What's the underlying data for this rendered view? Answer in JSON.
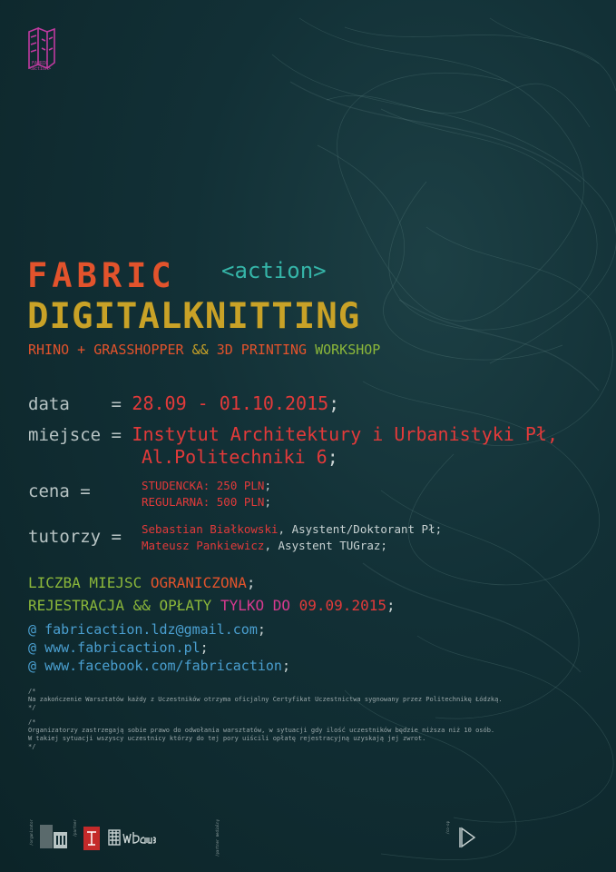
{
  "logo": {
    "caption_line1": "FABRIC",
    "caption_line2": "<action>"
  },
  "title": {
    "fabric": "FABRIC",
    "action": "<action>",
    "digital": "DIGITALKNITTING"
  },
  "subtitle": {
    "part1": "RHINO + GRASSHOPPER",
    "part2": "&&",
    "part3": "3D PRINTING",
    "part4": "WORKSHOP"
  },
  "info": {
    "data_label": "data    =",
    "data_value": "28.09 - 01.10.2015",
    "data_end": ";",
    "miejsce_label": "miejsce =",
    "miejsce_value1": "Instytut Architektury i Urbanistyki Pł,",
    "miejsce_value2": "Al.Politechniki 6",
    "miejsce_end": ";",
    "cena_label": "cena    =",
    "cena_value1": "STUDENCKA: 250 PLN",
    "cena_value2": "REGULARNA: 500 PLN",
    "semi": ";",
    "tutorzy_label": "tutorzy =",
    "tutor1_name": "Sebastian Białkowski",
    "tutor1_role": ", Asystent/Doktorant Pł;",
    "tutor2_name": "Mateusz Pankiewicz",
    "tutor2_role": ", Asystent TUGraz;"
  },
  "notice": {
    "line1_a": "LICZBA MIEJSC",
    "line1_b": "OGRANICZONA",
    "line1_c": ";",
    "line2_a": "REJESTRACJA && OPŁATY",
    "line2_b": "TYLKO DO",
    "line2_c": "09.09.2015",
    "line2_d": ";"
  },
  "contacts": [
    {
      "at": "@",
      "text": "fabricaction.ldz@gmail.com",
      "end": ";"
    },
    {
      "at": "@",
      "text": "www.fabricaction.pl",
      "end": ";"
    },
    {
      "at": "@",
      "text": "www.facebook.com/fabricaction",
      "end": ";"
    }
  ],
  "notes": {
    "n1_open": "/*",
    "n1_text": "Na zakończenie Warsztatów każdy z Uczestników otrzyma oficjalny Certyfikat Uczestnictwa sygnowany przez Politechnikę Łódzką.",
    "n1_close": "*/",
    "n2_open": "/*",
    "n2_text1": "Organizatorzy zastrzegają sobie prawo do odwołania warsztatów, w sytuacji gdy ilość uczestników będzie niższa niż 10 osób.",
    "n2_text2": "W takiej sytuacji wszyscy uczestnicy którzy do tej pory uiścili opłatę rejestracyjną uzyskają jej zwrot.",
    "n2_close": "*/"
  },
  "sponsors": {
    "organizator": "/organizator",
    "partner": "/partner",
    "medialny": "/partner medialny",
    "coop": "/co-op"
  },
  "colors": {
    "orange": "#e2532c",
    "yellow": "#c9a227",
    "green": "#8bb73a",
    "red": "#e23a3a",
    "magenta": "#d73a8f",
    "blue": "#4a9fd0",
    "teal": "#35b5a8",
    "background": "#0f2a30"
  }
}
